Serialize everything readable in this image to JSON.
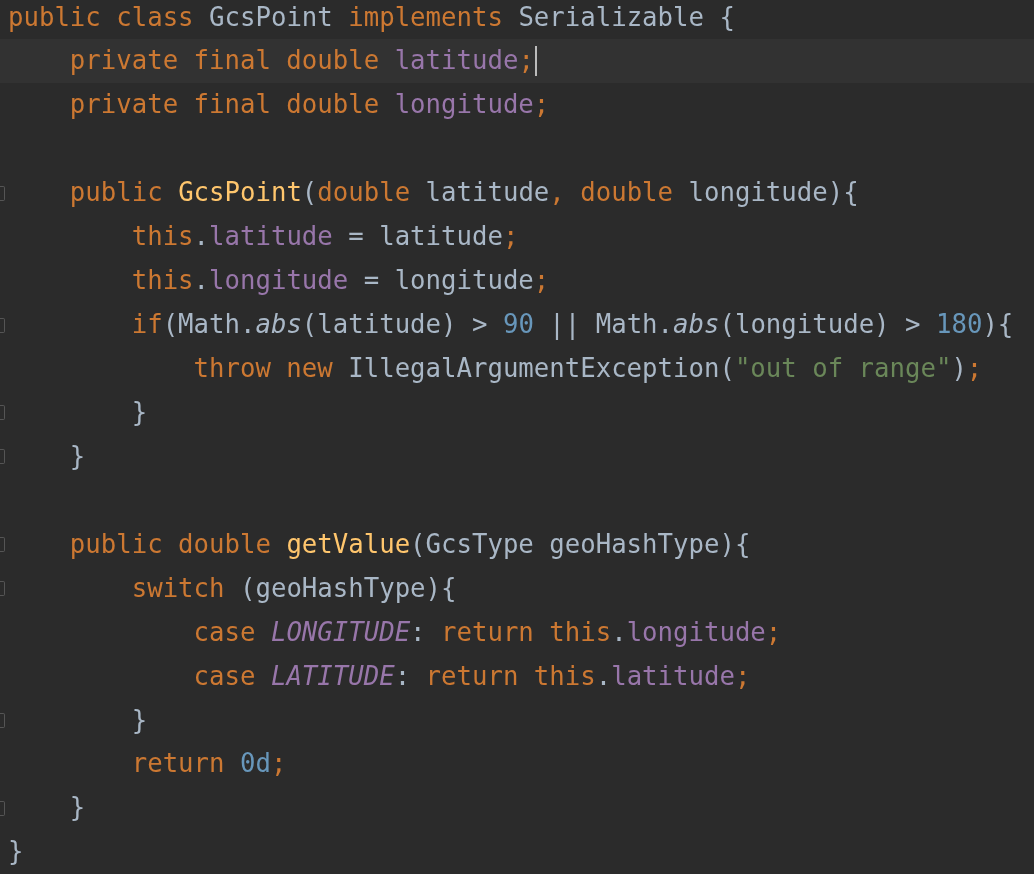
{
  "editor": {
    "lines": [
      {
        "caret": false,
        "foldable": false,
        "tokens": [
          {
            "kind": "keyword",
            "text": "public class "
          },
          {
            "kind": "plain",
            "text": "GcsPoint "
          },
          {
            "kind": "keyword",
            "text": "implements "
          },
          {
            "kind": "plain",
            "text": "Serializable {"
          }
        ]
      },
      {
        "caret": true,
        "foldable": false,
        "tokens": [
          {
            "kind": "keyword",
            "text": "    private final double "
          },
          {
            "kind": "field",
            "text": "latitude"
          },
          {
            "kind": "keyword",
            "text": ";"
          }
        ]
      },
      {
        "caret": false,
        "foldable": false,
        "tokens": [
          {
            "kind": "keyword",
            "text": "    private final double "
          },
          {
            "kind": "field",
            "text": "longitude"
          },
          {
            "kind": "keyword",
            "text": ";"
          }
        ]
      },
      {
        "caret": false,
        "foldable": false
      },
      {
        "caret": false,
        "foldable": true,
        "tokens": [
          {
            "kind": "keyword",
            "text": "    public "
          },
          {
            "kind": "function",
            "text": "GcsPoint"
          },
          {
            "kind": "plain",
            "text": "("
          },
          {
            "kind": "keyword",
            "text": "double "
          },
          {
            "kind": "plain",
            "text": "latitude"
          },
          {
            "kind": "keyword",
            "text": ", double "
          },
          {
            "kind": "plain",
            "text": "longitude){"
          }
        ]
      },
      {
        "caret": false,
        "foldable": false,
        "tokens": [
          {
            "kind": "keyword",
            "text": "        this"
          },
          {
            "kind": "plain",
            "text": "."
          },
          {
            "kind": "field",
            "text": "latitude"
          },
          {
            "kind": "plain",
            "text": " = latitude"
          },
          {
            "kind": "keyword",
            "text": ";"
          }
        ]
      },
      {
        "caret": false,
        "foldable": false,
        "tokens": [
          {
            "kind": "keyword",
            "text": "        this"
          },
          {
            "kind": "plain",
            "text": "."
          },
          {
            "kind": "field",
            "text": "longitude"
          },
          {
            "kind": "plain",
            "text": " = longitude"
          },
          {
            "kind": "keyword",
            "text": ";"
          }
        ]
      },
      {
        "caret": false,
        "foldable": true,
        "tokens": [
          {
            "kind": "keyword",
            "text": "        if"
          },
          {
            "kind": "plain",
            "text": "(Math."
          },
          {
            "kind": "static_call",
            "text": "abs"
          },
          {
            "kind": "plain",
            "text": "(latitude) > "
          },
          {
            "kind": "number",
            "text": "90"
          },
          {
            "kind": "plain",
            "text": " || Math."
          },
          {
            "kind": "static_call",
            "text": "abs"
          },
          {
            "kind": "plain",
            "text": "(longitude) > "
          },
          {
            "kind": "number",
            "text": "180"
          },
          {
            "kind": "plain",
            "text": "){"
          }
        ]
      },
      {
        "caret": false,
        "foldable": false,
        "tokens": [
          {
            "kind": "keyword",
            "text": "            throw new "
          },
          {
            "kind": "plain",
            "text": "IllegalArgumentException("
          },
          {
            "kind": "string",
            "text": "\"out of range\""
          },
          {
            "kind": "plain",
            "text": ")"
          },
          {
            "kind": "keyword",
            "text": ";"
          }
        ]
      },
      {
        "caret": false,
        "foldable": true,
        "tokens": [
          {
            "kind": "plain",
            "text": "        }"
          }
        ]
      },
      {
        "caret": false,
        "foldable": true,
        "tokens": [
          {
            "kind": "plain",
            "text": "    }"
          }
        ]
      },
      {
        "caret": false,
        "foldable": false
      },
      {
        "caret": false,
        "foldable": true,
        "tokens": [
          {
            "kind": "keyword",
            "text": "    public double "
          },
          {
            "kind": "function",
            "text": "getValue"
          },
          {
            "kind": "plain",
            "text": "(GcsType geoHashType){"
          }
        ]
      },
      {
        "caret": false,
        "foldable": true,
        "tokens": [
          {
            "kind": "keyword",
            "text": "        switch "
          },
          {
            "kind": "plain",
            "text": "(geoHashType){"
          }
        ]
      },
      {
        "caret": false,
        "foldable": false,
        "tokens": [
          {
            "kind": "keyword",
            "text": "            case "
          },
          {
            "kind": "constant",
            "text": "LONGITUDE"
          },
          {
            "kind": "plain",
            "text": ": "
          },
          {
            "kind": "keyword",
            "text": "return this"
          },
          {
            "kind": "plain",
            "text": "."
          },
          {
            "kind": "field",
            "text": "longitude"
          },
          {
            "kind": "keyword",
            "text": ";"
          }
        ]
      },
      {
        "caret": false,
        "foldable": false,
        "tokens": [
          {
            "kind": "keyword",
            "text": "            case "
          },
          {
            "kind": "constant",
            "text": "LATITUDE"
          },
          {
            "kind": "plain",
            "text": ": "
          },
          {
            "kind": "keyword",
            "text": "return this"
          },
          {
            "kind": "plain",
            "text": "."
          },
          {
            "kind": "field",
            "text": "latitude"
          },
          {
            "kind": "keyword",
            "text": ";"
          }
        ]
      },
      {
        "caret": false,
        "foldable": true,
        "tokens": [
          {
            "kind": "plain",
            "text": "        }"
          }
        ]
      },
      {
        "caret": false,
        "foldable": false,
        "tokens": [
          {
            "kind": "keyword",
            "text": "        return "
          },
          {
            "kind": "number",
            "text": "0d"
          },
          {
            "kind": "keyword",
            "text": ";"
          }
        ]
      },
      {
        "caret": false,
        "foldable": true,
        "tokens": [
          {
            "kind": "plain",
            "text": "    }"
          }
        ]
      },
      {
        "caret": false,
        "foldable": false,
        "tokens": [
          {
            "kind": "plain",
            "text": "}"
          }
        ]
      }
    ]
  }
}
